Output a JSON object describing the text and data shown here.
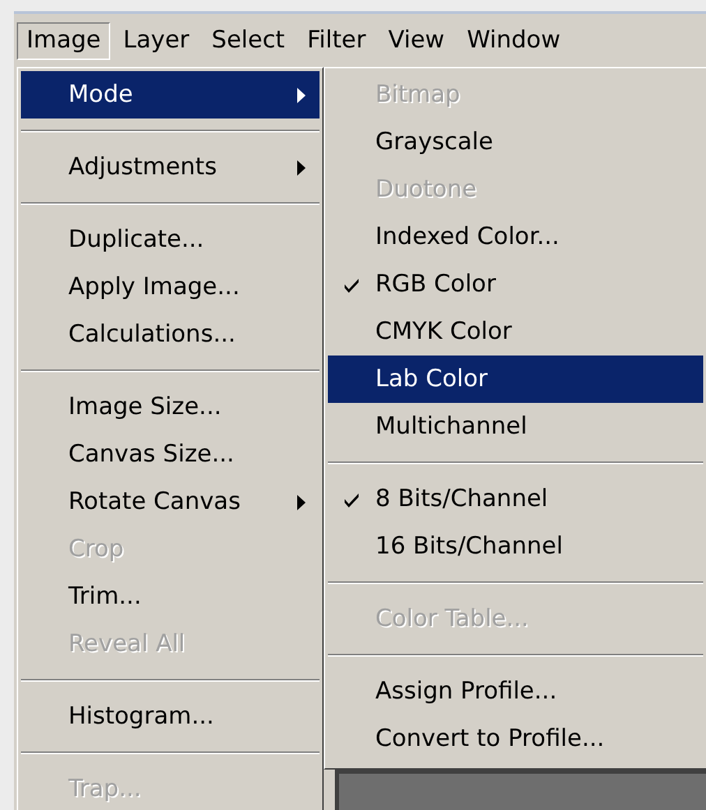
{
  "menubar": [
    {
      "label": "Image",
      "selected": true
    },
    {
      "label": "Layer",
      "selected": false
    },
    {
      "label": "Select",
      "selected": false
    },
    {
      "label": "Filter",
      "selected": false
    },
    {
      "label": "View",
      "selected": false
    },
    {
      "label": "Window",
      "selected": false
    }
  ],
  "menu": [
    {
      "kind": "item",
      "label": "Mode",
      "submenu": true,
      "disabled": false,
      "selected": true
    },
    {
      "kind": "separator"
    },
    {
      "kind": "item",
      "label": "Adjustments",
      "submenu": true,
      "disabled": false,
      "selected": false
    },
    {
      "kind": "separator"
    },
    {
      "kind": "item",
      "label": "Duplicate...",
      "submenu": false,
      "disabled": false,
      "selected": false
    },
    {
      "kind": "item",
      "label": "Apply Image...",
      "submenu": false,
      "disabled": false,
      "selected": false
    },
    {
      "kind": "item",
      "label": "Calculations...",
      "submenu": false,
      "disabled": false,
      "selected": false
    },
    {
      "kind": "separator"
    },
    {
      "kind": "item",
      "label": "Image Size...",
      "submenu": false,
      "disabled": false,
      "selected": false
    },
    {
      "kind": "item",
      "label": "Canvas Size...",
      "submenu": false,
      "disabled": false,
      "selected": false
    },
    {
      "kind": "item",
      "label": "Rotate Canvas",
      "submenu": true,
      "disabled": false,
      "selected": false
    },
    {
      "kind": "item",
      "label": "Crop",
      "submenu": false,
      "disabled": true,
      "selected": false
    },
    {
      "kind": "item",
      "label": "Trim...",
      "submenu": false,
      "disabled": false,
      "selected": false
    },
    {
      "kind": "item",
      "label": "Reveal All",
      "submenu": false,
      "disabled": true,
      "selected": false
    },
    {
      "kind": "separator"
    },
    {
      "kind": "item",
      "label": "Histogram...",
      "submenu": false,
      "disabled": false,
      "selected": false
    },
    {
      "kind": "separator"
    },
    {
      "kind": "item",
      "label": "Trap...",
      "submenu": false,
      "disabled": true,
      "selected": false
    }
  ],
  "submenu": [
    {
      "kind": "item",
      "label": "Bitmap",
      "checked": false,
      "disabled": true,
      "selected": false
    },
    {
      "kind": "item",
      "label": "Grayscale",
      "checked": false,
      "disabled": false,
      "selected": false
    },
    {
      "kind": "item",
      "label": "Duotone",
      "checked": false,
      "disabled": true,
      "selected": false
    },
    {
      "kind": "item",
      "label": "Indexed Color...",
      "checked": false,
      "disabled": false,
      "selected": false
    },
    {
      "kind": "item",
      "label": "RGB Color",
      "checked": true,
      "disabled": false,
      "selected": false
    },
    {
      "kind": "item",
      "label": "CMYK Color",
      "checked": false,
      "disabled": false,
      "selected": false
    },
    {
      "kind": "item",
      "label": "Lab Color",
      "checked": false,
      "disabled": false,
      "selected": true
    },
    {
      "kind": "item",
      "label": "Multichannel",
      "checked": false,
      "disabled": false,
      "selected": false
    },
    {
      "kind": "separator"
    },
    {
      "kind": "item",
      "label": "8 Bits/Channel",
      "checked": true,
      "disabled": false,
      "selected": false
    },
    {
      "kind": "item",
      "label": "16 Bits/Channel",
      "checked": false,
      "disabled": false,
      "selected": false
    },
    {
      "kind": "separator"
    },
    {
      "kind": "item",
      "label": "Color Table...",
      "checked": false,
      "disabled": true,
      "selected": false
    },
    {
      "kind": "separator"
    },
    {
      "kind": "item",
      "label": "Assign Profile...",
      "checked": false,
      "disabled": false,
      "selected": false
    },
    {
      "kind": "item",
      "label": "Convert to Profile...",
      "checked": false,
      "disabled": false,
      "selected": false
    }
  ]
}
